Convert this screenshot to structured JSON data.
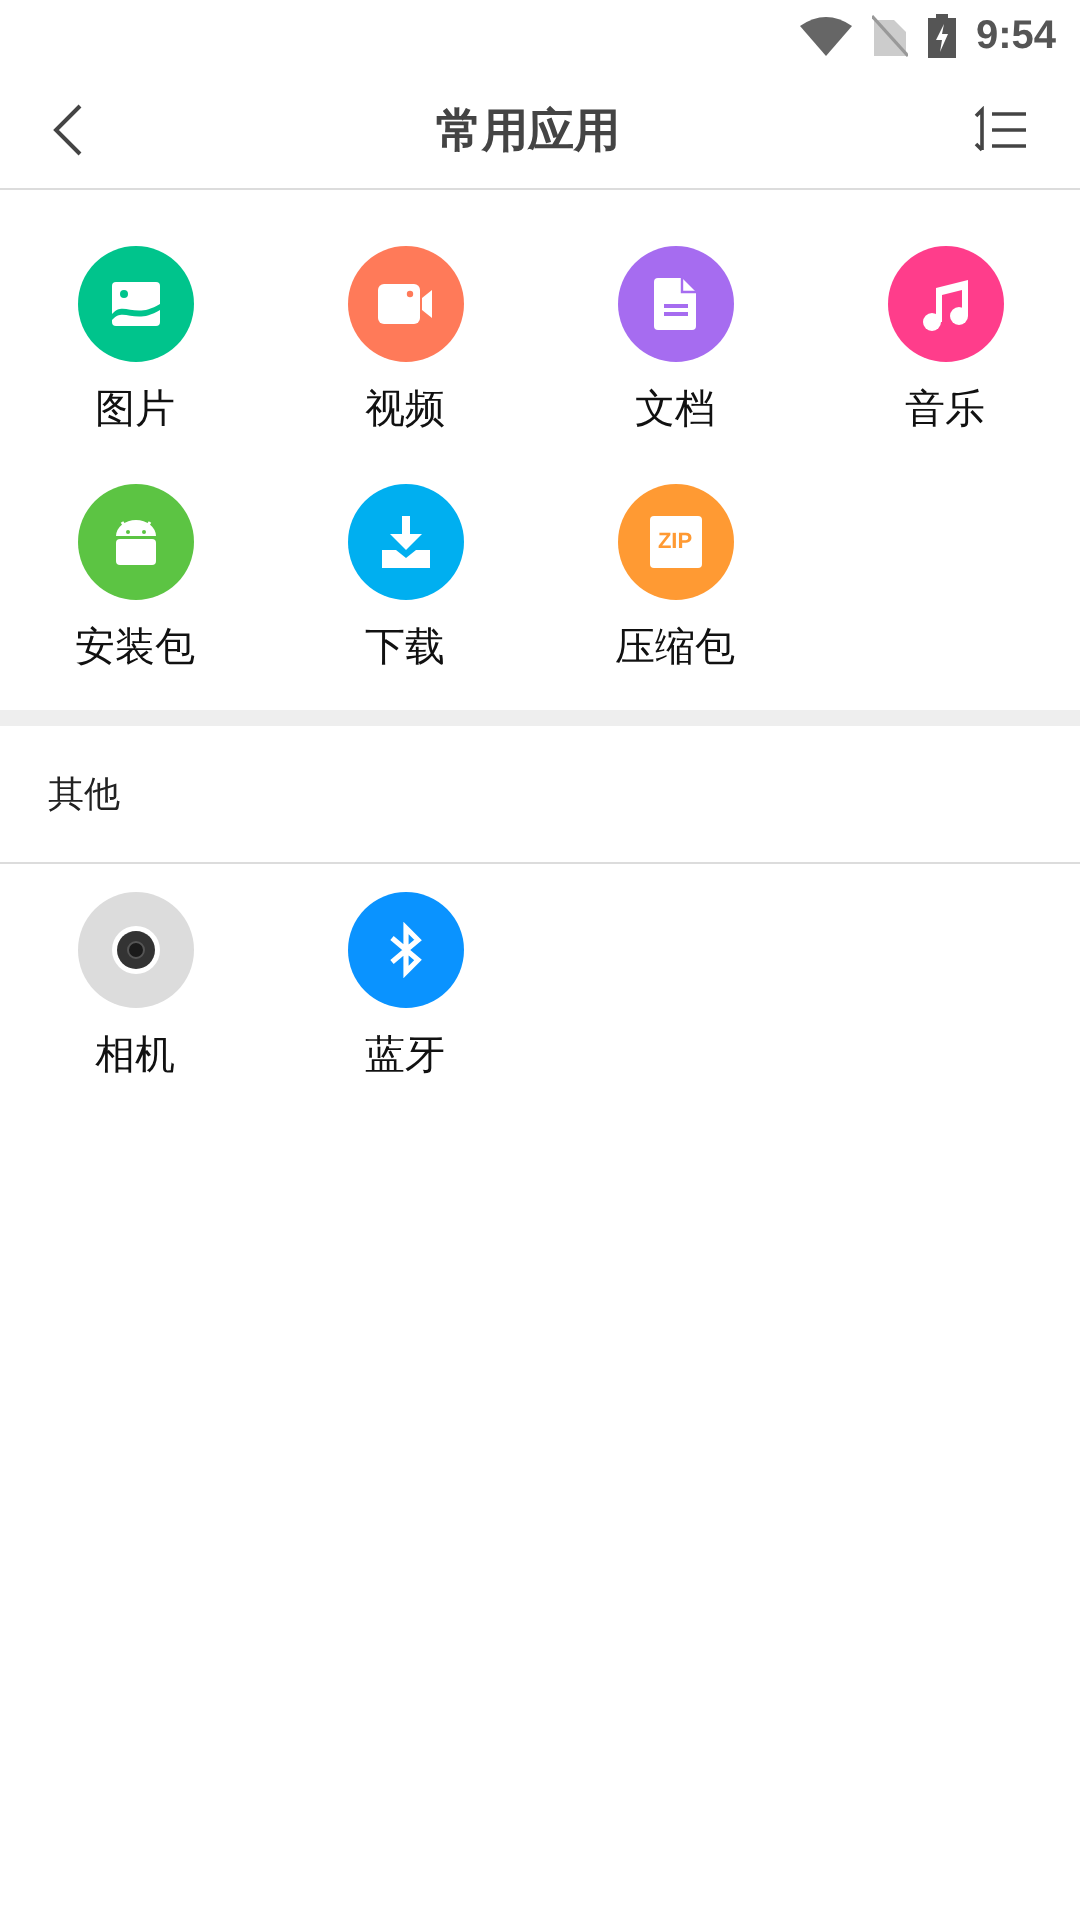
{
  "status_bar": {
    "time": "9:54"
  },
  "header": {
    "title": "常用应用"
  },
  "apps": [
    {
      "label": "图片",
      "kind": "image",
      "color": "#00c48c"
    },
    {
      "label": "视频",
      "kind": "video",
      "color": "#ff7a59"
    },
    {
      "label": "文档",
      "kind": "document",
      "color": "#a66cf0"
    },
    {
      "label": "音乐",
      "kind": "music",
      "color": "#ff3d8b"
    },
    {
      "label": "安装包",
      "kind": "android",
      "color": "#5cc443"
    },
    {
      "label": "下载",
      "kind": "download",
      "color": "#00aff0"
    },
    {
      "label": "压缩包",
      "kind": "zip",
      "color": "#ff9a33",
      "icon_text": "ZIP"
    }
  ],
  "other_section": {
    "title": "其他",
    "items": [
      {
        "label": "相机",
        "kind": "camera",
        "color": "#dcdcdc"
      },
      {
        "label": "蓝牙",
        "kind": "bluetooth",
        "color": "#0a93ff"
      }
    ]
  }
}
